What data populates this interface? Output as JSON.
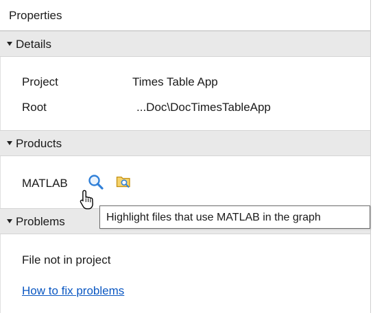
{
  "panel": {
    "title": "Properties"
  },
  "details": {
    "header": "Details",
    "rows": [
      {
        "label": "Project",
        "value": "Times Table App"
      },
      {
        "label": "Root",
        "value": "...Doc\\DocTimesTableApp"
      }
    ]
  },
  "products": {
    "header": "Products",
    "items": [
      {
        "name": "MATLAB",
        "highlight_icon": "magnifier-icon",
        "open_icon": "folder-search-icon"
      }
    ]
  },
  "problems": {
    "header": "Problems",
    "status": "File not in project",
    "fix_link": "How to fix problems"
  },
  "tooltip": {
    "text": "Highlight files that use MATLAB in the graph"
  },
  "colors": {
    "section_header_bg": "#e9e9e9",
    "link": "#0a57c2",
    "icon_blue": "#2f7fd8",
    "folder_yellow": "#e7b531"
  }
}
